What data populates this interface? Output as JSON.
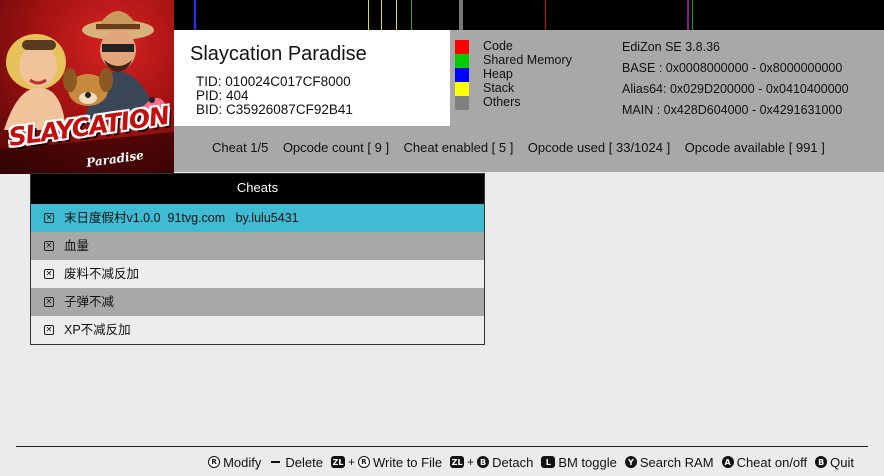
{
  "game": {
    "title": "Slaycation Paradise",
    "tid_line": "TID: 010024C017CF8000",
    "pid_line": "PID: 404",
    "bid_line": "BID: C35926087CF92B41",
    "logo_title": "SLAYCATION",
    "logo_subtitle": "Paradise"
  },
  "legend": [
    {
      "label": "Code",
      "color": "#ff0000"
    },
    {
      "label": "Shared Memory",
      "color": "#00cc00"
    },
    {
      "label": "Heap",
      "color": "#0000ff"
    },
    {
      "label": "Stack",
      "color": "#ffff00"
    },
    {
      "label": "Others",
      "color": "#808080"
    }
  ],
  "memory": {
    "version": "EdiZon SE 3.8.36",
    "base": "BASE  :  0x0008000000 - 0x8000000000",
    "alias64": "Alias64:  0x029D200000 - 0x0410400000",
    "main": "MAIN  :  0x428D604000 - 0x4291631000"
  },
  "status": {
    "text": "Cheat 1/5    Opcode count [ 9 ]    Cheat enabled [ 5 ]    Opcode used [ 33/1024 ]    Opcode available [ 991 ]"
  },
  "cheats": {
    "header": "Cheats",
    "items": [
      {
        "label": "末日度假村v1.0.0  91tvg.com   by.lulu5431",
        "enabled": true
      },
      {
        "label": "血量",
        "enabled": true
      },
      {
        "label": "废料不减反加",
        "enabled": true
      },
      {
        "label": "子弹不减",
        "enabled": true
      },
      {
        "label": "XP不减反加",
        "enabled": true
      }
    ]
  },
  "footer": {
    "modify": "Modify",
    "delete": "Delete",
    "write_to_file": "Write to File",
    "detach": "Detach",
    "bm_toggle": "BM toggle",
    "search_ram": "Search RAM",
    "cheat_on_off": "Cheat on/off",
    "quit": "Quit"
  }
}
